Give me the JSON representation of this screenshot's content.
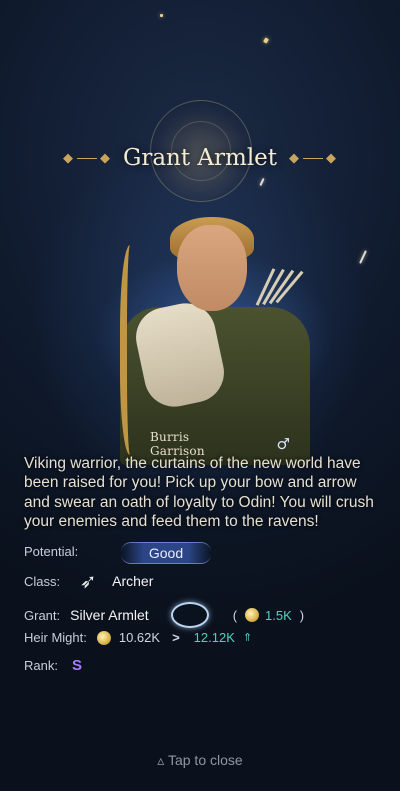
{
  "title": "Grant Armlet",
  "hero": {
    "name": "Burris Garrison",
    "gender_symbol": "♂",
    "description": "Viking warrior, the curtains of the new world have been raised for you! Pick up your bow and arrow and swear an oath of loyalty to Odin! You will crush your enemies and feed them to the ravens!"
  },
  "stats": {
    "potential_label": "Potential:",
    "potential_value": "Good",
    "class_label": "Class:",
    "class_value": "Archer",
    "class_icon": "bow-icon",
    "grant_label": "Grant:",
    "grant_value": "Silver Armlet",
    "grant_item_icon": "armlet-icon",
    "grant_paren_open": "(",
    "grant_might_gain": "1.5K",
    "grant_paren_close": ")",
    "heir_might_label": "Heir Might:",
    "heir_might_current": "10.62K",
    "heir_might_arrow": ">",
    "heir_might_new": "12.12K",
    "heir_might_up": "⇑",
    "rank_label": "Rank:",
    "rank_value": "S"
  },
  "footer": {
    "tap_icon": "▵",
    "tap_text": "Tap to close"
  },
  "colors": {
    "accent_teal": "#4fd2bf",
    "rank_purple": "#a77bff",
    "gold": "#c9a45c"
  }
}
